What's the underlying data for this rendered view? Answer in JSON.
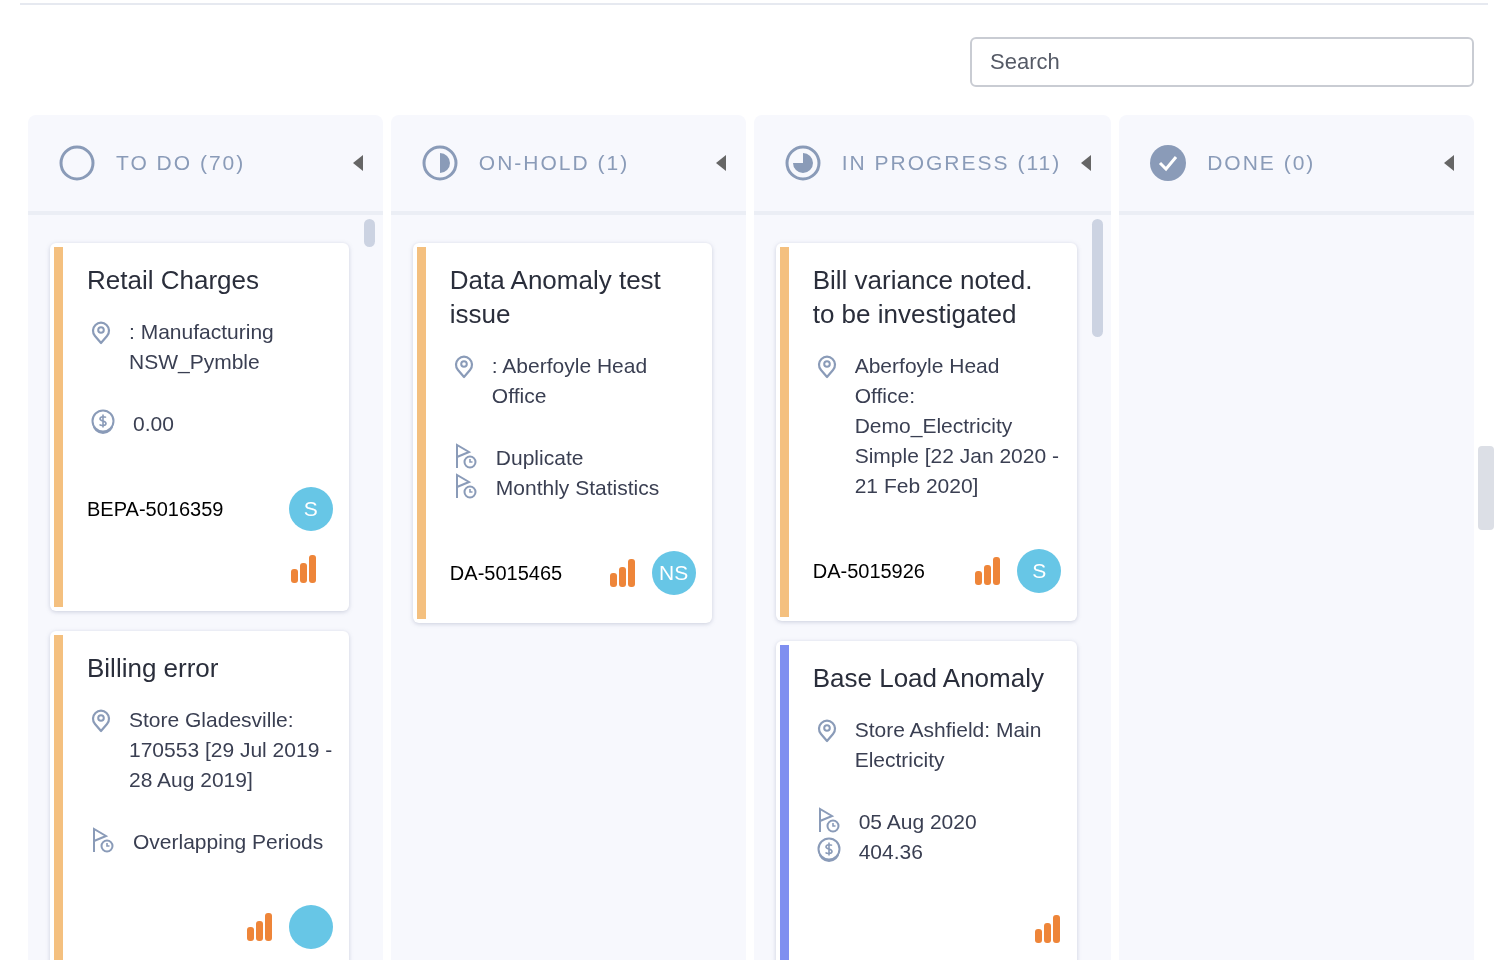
{
  "search": {
    "placeholder": "Search"
  },
  "columns": [
    {
      "kind": "todo",
      "title": "TO DO (70)",
      "cards": [
        {
          "kind": "stacked",
          "color": "#f4c07f",
          "title": "Retail Charges",
          "rows": [
            {
              "kind": "location",
              "text": ": Manufacturing NSW_Pymble"
            },
            {
              "kind": "money",
              "text": "0.00"
            }
          ],
          "id": "BEPA-5016359",
          "avatar_shown": true,
          "avatar_initials": "S"
        },
        {
          "kind": "inline",
          "color": "#f4c07f",
          "title": "Billing error",
          "rows": [
            {
              "kind": "location",
              "text": "Store Gladesville: 170553 [29 Jul 2019 - 28 Aug 2019]"
            },
            {
              "kind": "flag",
              "text": "Overlapping Periods"
            }
          ],
          "avatar_shown": true
        }
      ]
    },
    {
      "kind": "onhold",
      "title": "ON-HOLD (1)",
      "cards": [
        {
          "kind": "inline",
          "color": "#f4c07f",
          "title": "Data Anomaly test issue",
          "rows": [
            {
              "kind": "location",
              "text": ": Aberfoyle Head Office"
            },
            {
              "kind": "flag",
              "text": "Duplicate"
            },
            {
              "kind": "flag",
              "text": "Monthly Statistics"
            }
          ],
          "id": "DA-5015465",
          "avatar_shown": true,
          "avatar_initials": "NS"
        }
      ]
    },
    {
      "kind": "inprogress",
      "title": "IN PROGRESS (11)",
      "cards": [
        {
          "kind": "inline",
          "color": "#f4c07f",
          "title": "Bill variance noted. to be investigated",
          "rows": [
            {
              "kind": "location",
              "text": "Aberfoyle Head Office: Demo_Electricity Simple [22 Jan 2020 - 21 Feb 2020]"
            }
          ],
          "id": "DA-5015926",
          "avatar_shown": true,
          "avatar_initials": "S"
        },
        {
          "kind": "inline",
          "color": "#7f8ff0",
          "title": "Base Load Anomaly",
          "rows": [
            {
              "kind": "location",
              "text": "Store Ashfield: Main Electricity"
            },
            {
              "kind": "flag",
              "text": "05 Aug 2020"
            },
            {
              "kind": "money",
              "text": "404.36"
            }
          ]
        }
      ]
    },
    {
      "kind": "done",
      "title": "DONE (0)"
    }
  ]
}
